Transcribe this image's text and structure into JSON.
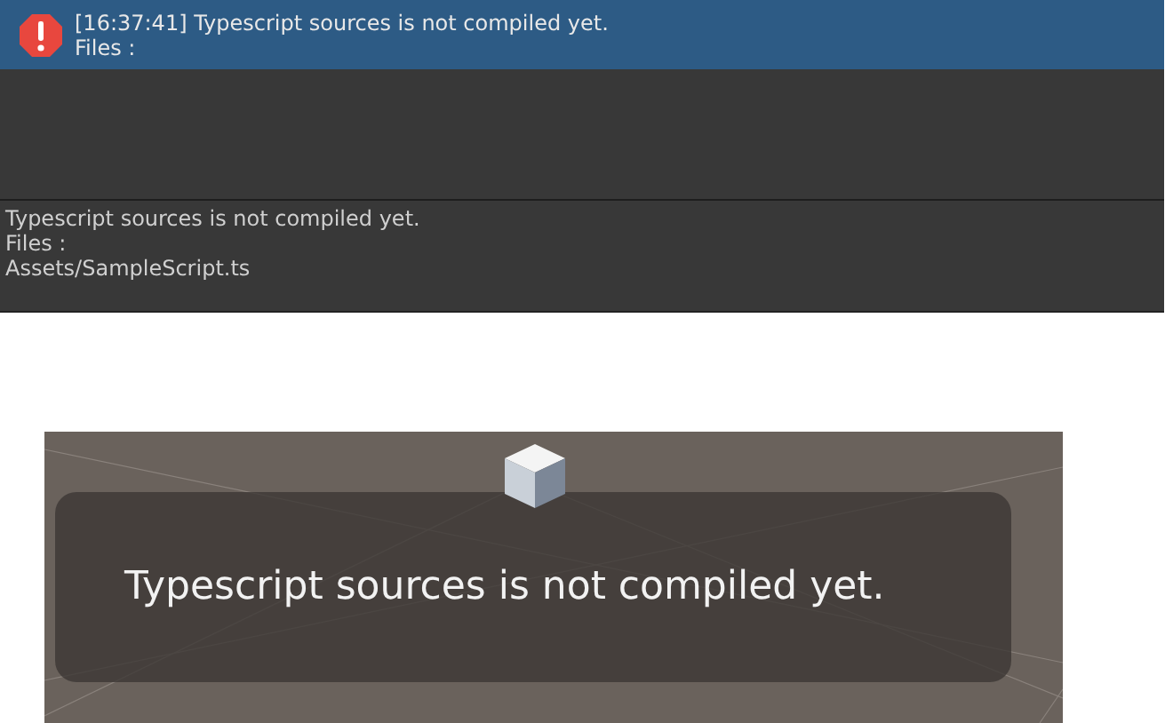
{
  "console": {
    "entries": [
      {
        "kind": "error",
        "selected": true,
        "lines": [
          "[16:37:41] Typescript sources is not compiled yet.",
          "Files :"
        ]
      }
    ],
    "detail": [
      "Typescript sources is not compiled yet.",
      "Files :",
      "Assets/SampleScript.ts"
    ]
  },
  "scene": {
    "notification": "Typescript sources is not compiled yet."
  }
}
